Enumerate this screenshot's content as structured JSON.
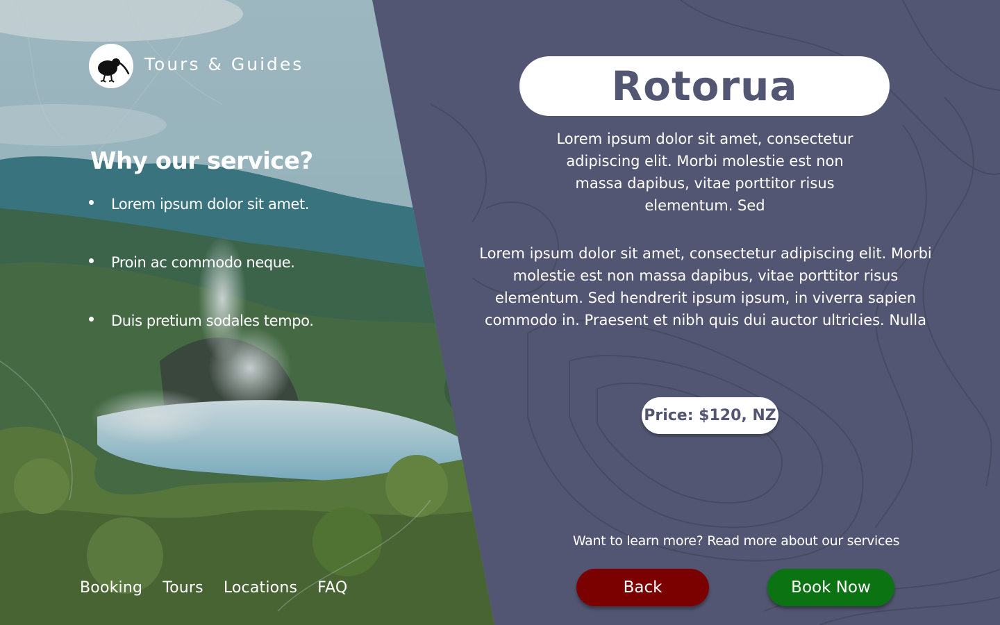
{
  "brand": {
    "name": "Tours & Guides",
    "logo_icon": "kiwi-bird-icon"
  },
  "why": {
    "title": "Why our service?",
    "bullets": [
      "Lorem ipsum dolor sit amet.",
      "Proin ac commodo neque.",
      "Duis pretium sodales tempo."
    ]
  },
  "footer_nav": [
    "Booking",
    "Tours",
    "Locations",
    "FAQ"
  ],
  "tour": {
    "title": "Rotorua",
    "description_short": "Lorem ipsum dolor sit amet, consectetur adipiscing elit. Morbi molestie est non massa dapibus, vitae porttitor risus elementum. Sed",
    "description_long": "Lorem ipsum dolor sit amet, consectetur adipiscing elit. Morbi molestie est non massa dapibus, vitae porttitor risus elementum. Sed hendrerit ipsum ipsum, in viverra sapien commodo in. Praesent et nibh quis dui auctor ultricies. Nulla",
    "price": "Price: $120, NZ"
  },
  "learn_more": "Want to learn more? Read more about our services",
  "buttons": {
    "back": "Back",
    "book": "Book Now"
  },
  "colors": {
    "panel": "#535672",
    "back_button": "#7b0000",
    "book_button": "#0b7311"
  }
}
